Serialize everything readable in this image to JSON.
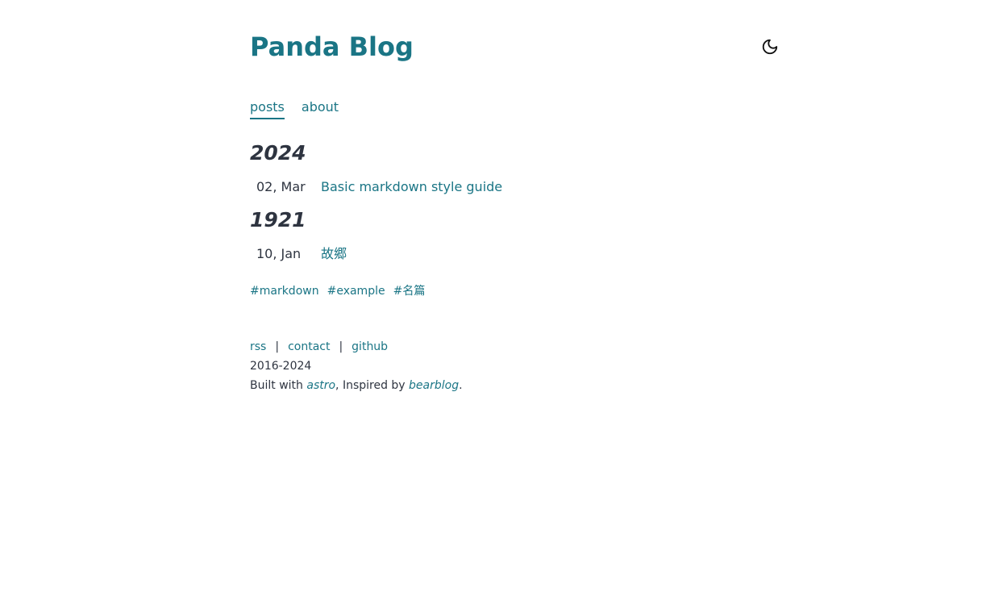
{
  "header": {
    "title": "Panda Blog",
    "theme_icon": "moon-icon"
  },
  "nav": {
    "items": [
      {
        "label": "posts",
        "active": true
      },
      {
        "label": "about",
        "active": false
      }
    ]
  },
  "posts_by_year": [
    {
      "year": "2024",
      "posts": [
        {
          "date": "02, Mar",
          "title": "Basic markdown style guide"
        }
      ]
    },
    {
      "year": "1921",
      "posts": [
        {
          "date": "10, Jan",
          "title": "故郷"
        }
      ]
    }
  ],
  "tags": [
    "#markdown",
    "#example",
    "#名篇"
  ],
  "footer": {
    "links": [
      "rss",
      "contact",
      "github"
    ],
    "separator": "|",
    "years": "2016-2024",
    "built_prefix": "Built with ",
    "built_link": "astro",
    "inspired_prefix": ", Inspired by ",
    "inspired_link": "bearblog",
    "end": "."
  },
  "colors": {
    "accent": "#1a7585",
    "text": "#2e3440",
    "background": "#ffffff"
  }
}
